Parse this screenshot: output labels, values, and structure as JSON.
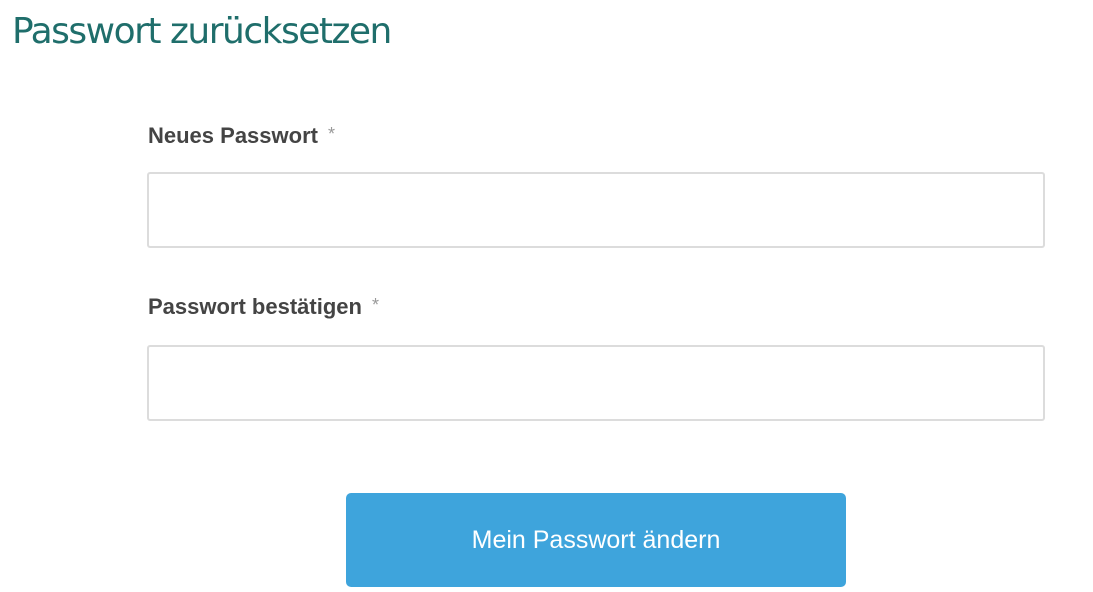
{
  "page": {
    "title": "Passwort zurücksetzen"
  },
  "form": {
    "new_password": {
      "label": "Neues Passwort",
      "required_mark": "*",
      "value": "",
      "placeholder": ""
    },
    "confirm_password": {
      "label": "Passwort bestätigen",
      "required_mark": "*",
      "value": "",
      "placeholder": ""
    },
    "submit_label": "Mein Passwort ändern"
  },
  "colors": {
    "title": "#1f6e6b",
    "button": "#3ea4dc",
    "label": "#444444"
  }
}
